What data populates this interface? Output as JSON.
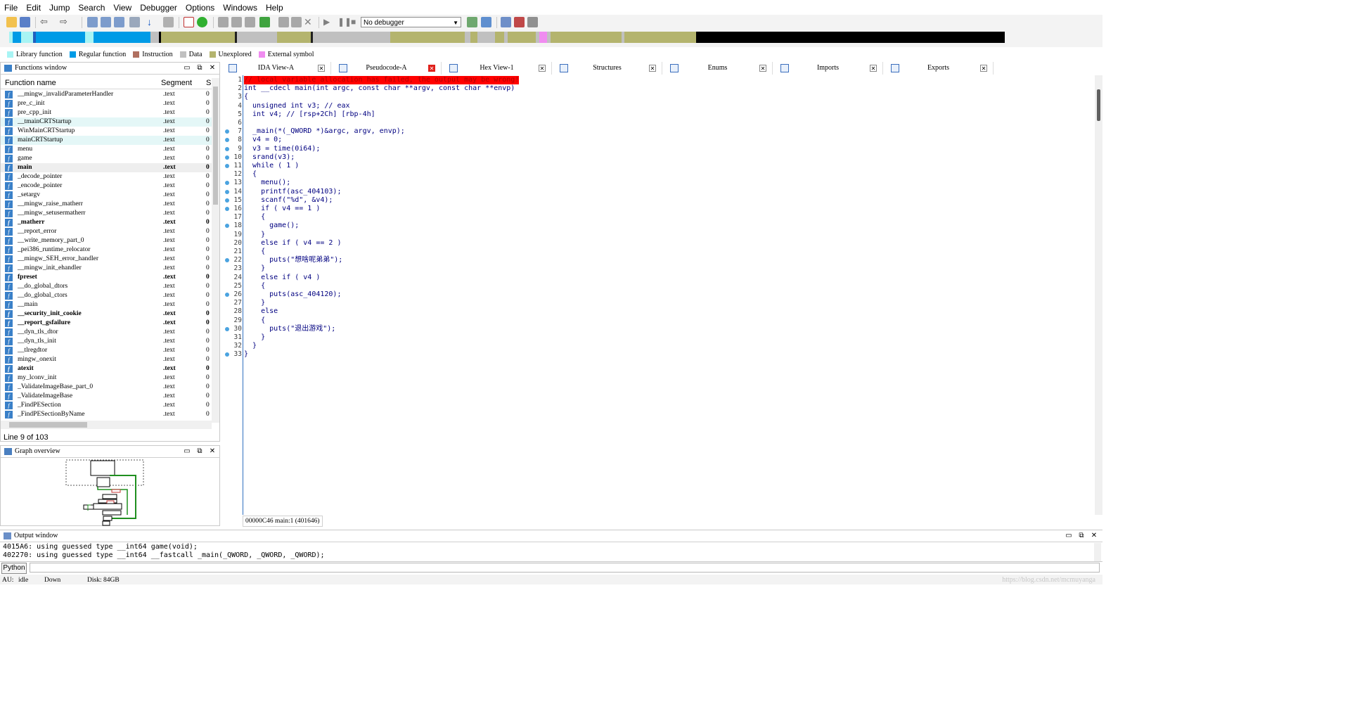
{
  "menu": [
    "File",
    "Edit",
    "Jump",
    "Search",
    "View",
    "Debugger",
    "Options",
    "Windows",
    "Help"
  ],
  "toolbar": {
    "debugger_select": "No debugger"
  },
  "legend": [
    {
      "label": "Library function",
      "color": "#a8f4f4"
    },
    {
      "label": "Regular function",
      "color": "#009be6"
    },
    {
      "label": "Instruction",
      "color": "#b07060"
    },
    {
      "label": "Data",
      "color": "#c0c0c0"
    },
    {
      "label": "Unexplored",
      "color": "#b4b46e"
    },
    {
      "label": "External symbol",
      "color": "#f08cf0"
    }
  ],
  "functions_window": {
    "title": "Functions window",
    "col_name": "Function name",
    "col_segment": "Segment",
    "col_s": "S",
    "rows": [
      {
        "name": "__mingw_invalidParameterHandler",
        "seg": ".text",
        "st": "0"
      },
      {
        "name": "pre_c_init",
        "seg": ".text",
        "st": "0"
      },
      {
        "name": "pre_cpp_init",
        "seg": ".text",
        "st": "0"
      },
      {
        "name": "__tmainCRTStartup",
        "seg": ".text",
        "st": "0"
      },
      {
        "name": "WinMainCRTStartup",
        "seg": ".text",
        "st": "0"
      },
      {
        "name": "mainCRTStartup",
        "seg": ".text",
        "st": "0"
      },
      {
        "name": "menu",
        "seg": ".text",
        "st": "0"
      },
      {
        "name": "game",
        "seg": ".text",
        "st": "0"
      },
      {
        "name": "main",
        "seg": ".text",
        "st": "0"
      },
      {
        "name": "_decode_pointer",
        "seg": ".text",
        "st": "0"
      },
      {
        "name": "_encode_pointer",
        "seg": ".text",
        "st": "0"
      },
      {
        "name": "_setargv",
        "seg": ".text",
        "st": "0"
      },
      {
        "name": "__mingw_raise_matherr",
        "seg": ".text",
        "st": "0"
      },
      {
        "name": "__mingw_setusermatherr",
        "seg": ".text",
        "st": "0"
      },
      {
        "name": "_matherr",
        "seg": ".text",
        "st": "0"
      },
      {
        "name": "__report_error",
        "seg": ".text",
        "st": "0"
      },
      {
        "name": "__write_memory_part_0",
        "seg": ".text",
        "st": "0"
      },
      {
        "name": "_pei386_runtime_relocator",
        "seg": ".text",
        "st": "0"
      },
      {
        "name": "__mingw_SEH_error_handler",
        "seg": ".text",
        "st": "0"
      },
      {
        "name": "__mingw_init_ehandler",
        "seg": ".text",
        "st": "0"
      },
      {
        "name": "fpreset",
        "seg": ".text",
        "st": "0"
      },
      {
        "name": "__do_global_dtors",
        "seg": ".text",
        "st": "0"
      },
      {
        "name": "__do_global_ctors",
        "seg": ".text",
        "st": "0"
      },
      {
        "name": "__main",
        "seg": ".text",
        "st": "0"
      },
      {
        "name": "__security_init_cookie",
        "seg": ".text",
        "st": "0"
      },
      {
        "name": "__report_gsfailure",
        "seg": ".text",
        "st": "0"
      },
      {
        "name": "__dyn_tls_dtor",
        "seg": ".text",
        "st": "0"
      },
      {
        "name": "__dyn_tls_init",
        "seg": ".text",
        "st": "0"
      },
      {
        "name": "__tlregdtor",
        "seg": ".text",
        "st": "0"
      },
      {
        "name": "mingw_onexit",
        "seg": ".text",
        "st": "0"
      },
      {
        "name": "atexit",
        "seg": ".text",
        "st": "0"
      },
      {
        "name": "my_lconv_init",
        "seg": ".text",
        "st": "0"
      },
      {
        "name": "_ValidateImageBase_part_0",
        "seg": ".text",
        "st": "0"
      },
      {
        "name": "_ValidateImageBase",
        "seg": ".text",
        "st": "0"
      },
      {
        "name": "_FindPESection",
        "seg": ".text",
        "st": "0"
      },
      {
        "name": "_FindPESectionByName",
        "seg": ".text",
        "st": "0"
      }
    ],
    "line_info": "Line 9 of 103"
  },
  "graph_overview": {
    "title": "Graph overview"
  },
  "tabs": [
    {
      "label": "IDA View-A"
    },
    {
      "label": "Pseudocode-A"
    },
    {
      "label": "Hex View-1"
    },
    {
      "label": "Structures"
    },
    {
      "label": "Enums"
    },
    {
      "label": "Imports"
    },
    {
      "label": "Exports"
    }
  ],
  "code": [
    "// local variable allocation has failed, the output may be wrong!",
    "int __cdecl main(int argc, const char **argv, const char **envp)",
    "{",
    "  unsigned int v3; // eax",
    "  int v4; // [rsp+2Ch] [rbp-4h]",
    "",
    "  _main(*(_QWORD *)&argc, argv, envp);",
    "  v4 = 0;",
    "  v3 = time(0i64);",
    "  srand(v3);",
    "  while ( 1 )",
    "  {",
    "    menu();",
    "    printf(asc_404103);",
    "    scanf(\"%d\", &v4);",
    "    if ( v4 == 1 )",
    "    {",
    "      game();",
    "    }",
    "    else if ( v4 == 2 )",
    "    {",
    "      puts(\"想啥呢弟弟\");",
    "    }",
    "    else if ( v4 )",
    "    {",
    "      puts(asc_404120);",
    "    }",
    "    else",
    "    {",
    "      puts(\"退出游戏\");",
    "    }",
    "  }",
    "}"
  ],
  "code_status": "00000C46 main:1 (401646)",
  "output_window": {
    "title": "Output window",
    "lines": [
      "4015A6: using guessed type __int64 game(void);",
      "402270: using guessed type __int64 __fastcall _main(_QWORD, _QWORD, _QWORD);"
    ]
  },
  "python_button": "Python",
  "statusbar": {
    "au": "AU:",
    "state": "idle",
    "dir": "Down",
    "disk": "Disk: 84GB"
  },
  "watermark": "https://blog.csdn.net/mcmuyanga"
}
